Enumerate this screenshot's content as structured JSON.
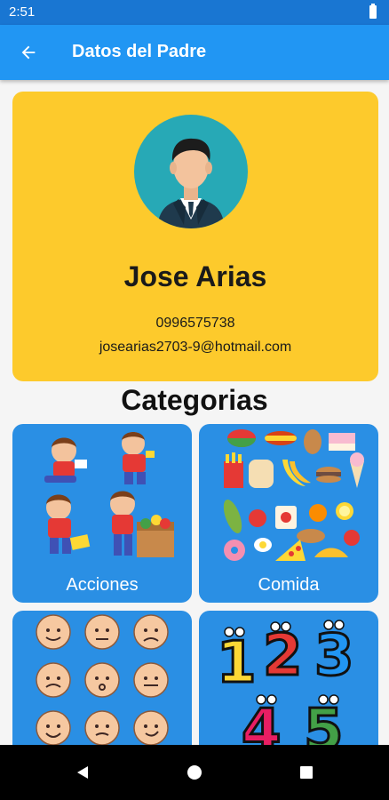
{
  "status_bar": {
    "time": "2:51"
  },
  "app_bar": {
    "title": "Datos del Padre",
    "back_icon": "arrow-left-icon"
  },
  "profile": {
    "name": "Jose Arias",
    "phone": "0996575738",
    "email": "josearias2703-9@hotmail.com"
  },
  "section_title": "Categorias",
  "categories": [
    {
      "label": "Acciones"
    },
    {
      "label": "Comida"
    },
    {
      "label": ""
    },
    {
      "label": ""
    }
  ],
  "colors": {
    "app_bar": "#2196f3",
    "status_bar": "#1976d2",
    "profile_card": "#fdca2c",
    "category_card": "#2a8fe4",
    "avatar_bg": "#27a9b6"
  }
}
